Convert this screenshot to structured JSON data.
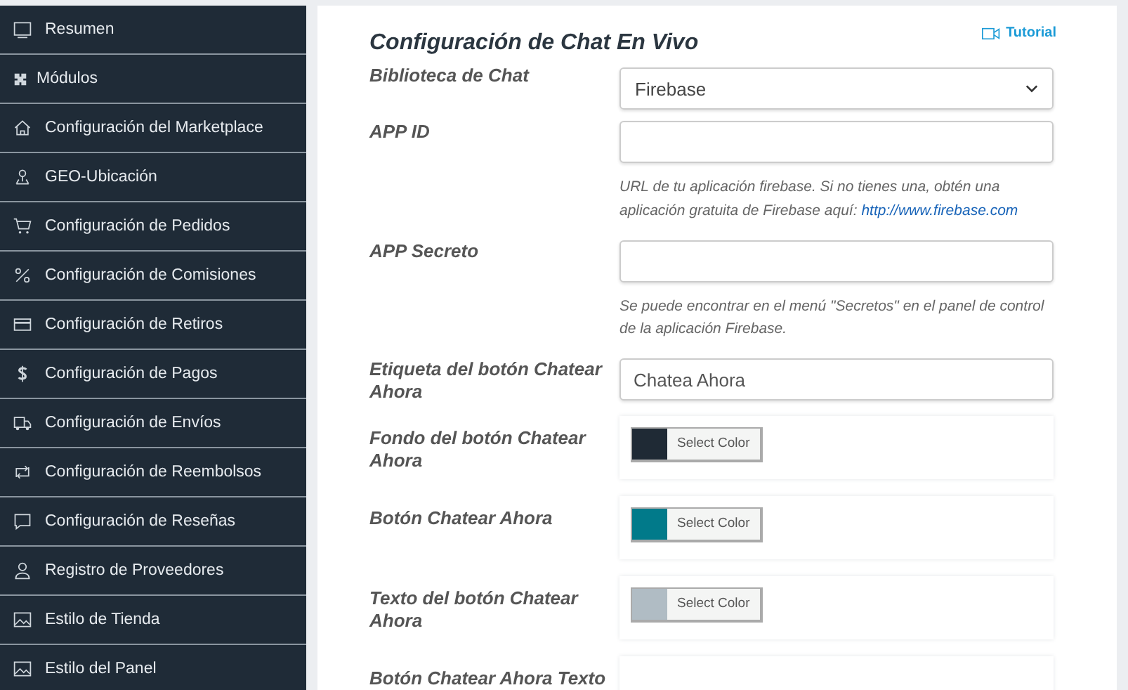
{
  "sidebar": {
    "items": [
      {
        "label": "Resumen",
        "selected": false
      },
      {
        "label": "Módulos",
        "selected": false
      },
      {
        "label": "Configuración del Marketplace",
        "selected": false
      },
      {
        "label": "GEO-Ubicación",
        "selected": false
      },
      {
        "label": "Configuración de Pedidos",
        "selected": false
      },
      {
        "label": "Configuración de Comisiones",
        "selected": false
      },
      {
        "label": "Configuración de Retiros",
        "selected": false
      },
      {
        "label": "Configuración de Pagos",
        "selected": false
      },
      {
        "label": "Configuración de Envíos",
        "selected": false
      },
      {
        "label": "Configuración de Reembolsos",
        "selected": false
      },
      {
        "label": "Configuración de Reseñas",
        "selected": false
      },
      {
        "label": "Registro de Proveedores",
        "selected": false
      },
      {
        "label": "Estilo de Tienda",
        "selected": false
      },
      {
        "label": "Estilo del Panel",
        "selected": false
      }
    ]
  },
  "panel": {
    "title": "Configuración de Chat En Vivo",
    "tutorial_link": "Tutorial",
    "fields": [
      {
        "kind": "select",
        "label": "Biblioteca de Chat",
        "value": "Firebase"
      },
      {
        "kind": "text",
        "label": "APP ID",
        "help": "URL de tu aplicación firebase. Si no tienes una, obtén una aplicación gratuita de Firebase aquí:",
        "help_link": "http://www.firebase.com"
      },
      {
        "kind": "text",
        "label": "APP Secreto",
        "help": "Se puede encontrar en el menú \"Secretos\" en el panel de control de la aplicación Firebase."
      },
      {
        "kind": "text",
        "label": "Etiqueta del botón Chatear Ahora",
        "value": "Chatea Ahora"
      },
      {
        "kind": "color",
        "label": "Fondo del botón Chatear Ahora",
        "color": "#1f2a35",
        "button": "Select Color"
      },
      {
        "kind": "color",
        "label": "Botón Chatear Ahora",
        "color": "#017a8a",
        "button": "Select Color"
      },
      {
        "kind": "color",
        "label": "Texto del botón Chatear Ahora",
        "color": "#b0bcc4",
        "button": "Select Color"
      },
      {
        "kind": "color",
        "label": "Botón Chatear Ahora Texto"
      }
    ]
  }
}
